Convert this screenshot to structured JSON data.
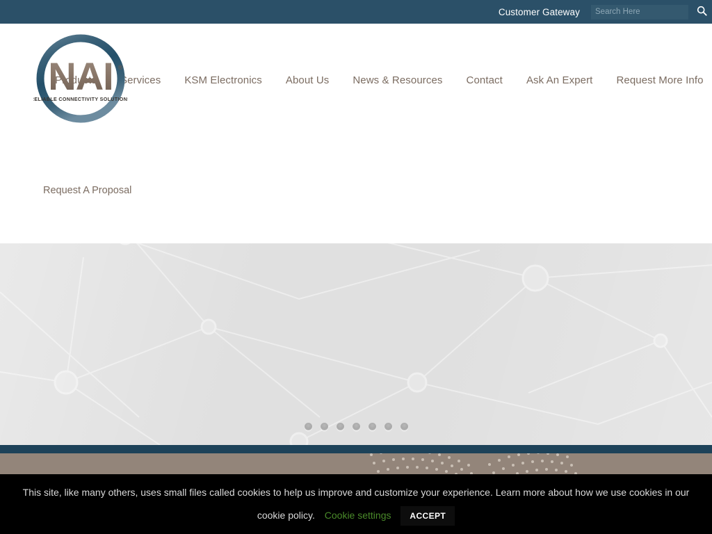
{
  "topbar": {
    "gateway_label": "Customer Gateway",
    "search_placeholder": "Search Here",
    "search_value": "",
    "search_icon": "search-icon",
    "background": "#2b5068"
  },
  "logo": {
    "wordmark": "NAI",
    "trademark": "®",
    "tagline": "RELIABLE CONNECTIVITY SOLUTIONS",
    "ring_color": "#2b5068",
    "wordmark_color": "#8a7a6d"
  },
  "mainnav": {
    "items": [
      {
        "label": "Products"
      },
      {
        "label": "Services"
      },
      {
        "label": "KSM Electronics"
      },
      {
        "label": "About Us"
      },
      {
        "label": "News & Resources"
      },
      {
        "label": "Contact"
      },
      {
        "label": "Ask An Expert"
      },
      {
        "label": "Request More Info"
      }
    ],
    "link_color": "#7b6c61"
  },
  "secondnav": {
    "items": [
      {
        "label": "Request A Proposal"
      }
    ]
  },
  "hero": {
    "background": "#e0e0e0",
    "dots": [
      {
        "index": 1,
        "active": false
      },
      {
        "index": 2,
        "active": false
      },
      {
        "index": 3,
        "active": false
      },
      {
        "index": 4,
        "active": false
      },
      {
        "index": 5,
        "active": false
      },
      {
        "index": 6,
        "active": false
      },
      {
        "index": 7,
        "active": false
      }
    ]
  },
  "divider": {
    "color": "#1d4259"
  },
  "footer_strip": {
    "color": "#93857a"
  },
  "cookie_banner": {
    "message": "This site, like many others, uses small files called cookies to help us improve and customize your experience. Learn more about how we use cookies in our cookie policy.",
    "settings_label": "Cookie settings",
    "accept_label": "ACCEPT",
    "settings_color": "#4a8a2a",
    "background": "#000000"
  }
}
